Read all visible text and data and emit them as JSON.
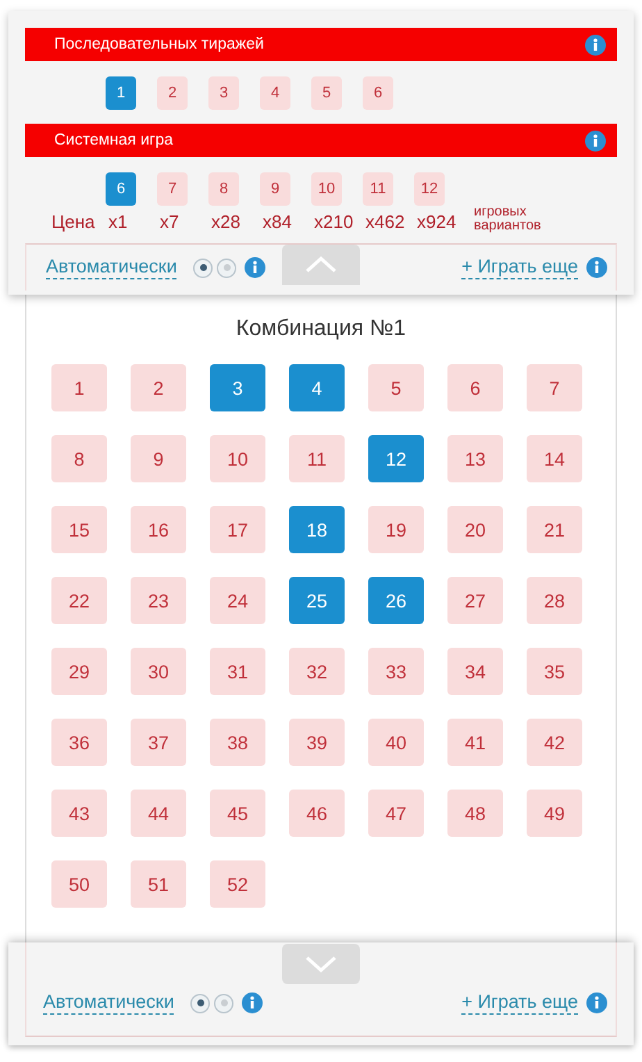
{
  "draws": {
    "title": "Последовательных тиражей",
    "options": [
      {
        "label": "1",
        "selected": true
      },
      {
        "label": "2",
        "selected": false
      },
      {
        "label": "3",
        "selected": false
      },
      {
        "label": "4",
        "selected": false
      },
      {
        "label": "5",
        "selected": false
      },
      {
        "label": "6",
        "selected": false
      }
    ]
  },
  "system_game": {
    "title": "Системная игра",
    "price_label": "Цена",
    "variants_label": "игровых вариантов",
    "options": [
      {
        "label": "6",
        "price": "x1",
        "selected": true
      },
      {
        "label": "7",
        "price": "x7",
        "selected": false
      },
      {
        "label": "8",
        "price": "x28",
        "selected": false
      },
      {
        "label": "9",
        "price": "x84",
        "selected": false
      },
      {
        "label": "10",
        "price": "x210",
        "selected": false
      },
      {
        "label": "11",
        "price": "x462",
        "selected": false
      },
      {
        "label": "12",
        "price": "x924",
        "selected": false
      }
    ]
  },
  "top_controls": {
    "auto_label": "Автоматически",
    "modes": [
      {
        "selected": true
      },
      {
        "selected": false
      }
    ],
    "play_more": "+ Играть еще"
  },
  "combination": {
    "title": "Комбинация №1",
    "numbers": [
      {
        "label": "1",
        "selected": false
      },
      {
        "label": "2",
        "selected": false
      },
      {
        "label": "3",
        "selected": true
      },
      {
        "label": "4",
        "selected": true
      },
      {
        "label": "5",
        "selected": false
      },
      {
        "label": "6",
        "selected": false
      },
      {
        "label": "7",
        "selected": false
      },
      {
        "label": "8",
        "selected": false
      },
      {
        "label": "9",
        "selected": false
      },
      {
        "label": "10",
        "selected": false
      },
      {
        "label": "11",
        "selected": false
      },
      {
        "label": "12",
        "selected": true
      },
      {
        "label": "13",
        "selected": false
      },
      {
        "label": "14",
        "selected": false
      },
      {
        "label": "15",
        "selected": false
      },
      {
        "label": "16",
        "selected": false
      },
      {
        "label": "17",
        "selected": false
      },
      {
        "label": "18",
        "selected": true
      },
      {
        "label": "19",
        "selected": false
      },
      {
        "label": "20",
        "selected": false
      },
      {
        "label": "21",
        "selected": false
      },
      {
        "label": "22",
        "selected": false
      },
      {
        "label": "23",
        "selected": false
      },
      {
        "label": "24",
        "selected": false
      },
      {
        "label": "25",
        "selected": true
      },
      {
        "label": "26",
        "selected": true
      },
      {
        "label": "27",
        "selected": false
      },
      {
        "label": "28",
        "selected": false
      },
      {
        "label": "29",
        "selected": false
      },
      {
        "label": "30",
        "selected": false
      },
      {
        "label": "31",
        "selected": false
      },
      {
        "label": "32",
        "selected": false
      },
      {
        "label": "33",
        "selected": false
      },
      {
        "label": "34",
        "selected": false
      },
      {
        "label": "35",
        "selected": false
      },
      {
        "label": "36",
        "selected": false
      },
      {
        "label": "37",
        "selected": false
      },
      {
        "label": "38",
        "selected": false
      },
      {
        "label": "39",
        "selected": false
      },
      {
        "label": "40",
        "selected": false
      },
      {
        "label": "41",
        "selected": false
      },
      {
        "label": "42",
        "selected": false
      },
      {
        "label": "43",
        "selected": false
      },
      {
        "label": "44",
        "selected": false
      },
      {
        "label": "45",
        "selected": false
      },
      {
        "label": "46",
        "selected": false
      },
      {
        "label": "47",
        "selected": false
      },
      {
        "label": "48",
        "selected": false
      },
      {
        "label": "49",
        "selected": false
      },
      {
        "label": "50",
        "selected": false
      },
      {
        "label": "51",
        "selected": false
      },
      {
        "label": "52",
        "selected": false
      }
    ]
  },
  "bottom_controls": {
    "auto_label": "Автоматически",
    "modes": [
      {
        "selected": true
      },
      {
        "selected": false
      }
    ],
    "play_more": "+ Играть еще"
  }
}
